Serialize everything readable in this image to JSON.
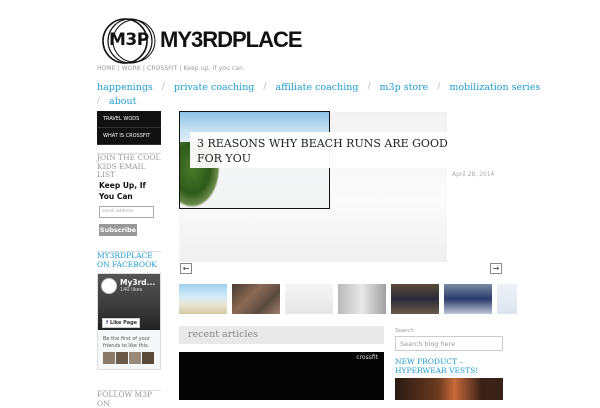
{
  "header": {
    "logo_mono": "M3P",
    "logo_word": "MY3RDPLACE",
    "tagline": "HOME | WORK | CROSSFIT | Keep up, if you can."
  },
  "nav": {
    "row1": [
      "happenings",
      "private coaching",
      "affiliate coaching",
      "m3p store",
      "mobilization series"
    ],
    "row2": [
      "about"
    ]
  },
  "sidebar": {
    "menu": [
      "TRAVEL WODS",
      "WHAT IS CROSSFIT"
    ],
    "email_heading": "JOIN THE COOL KIDS EMAIL LIST",
    "keep_up": "Keep Up, If You Can",
    "email_placeholder": "email address",
    "subscribe_label": "Subscribe",
    "facebook_heading": "MY3RDPLACE ON FACEBOOK",
    "facebook": {
      "page_name": "My3rd...",
      "likes": "140 likes",
      "like_button": "Like Page",
      "friends_text": "Be the first of your friends to like this."
    },
    "follow_heading": "FOLLOW M3P ON"
  },
  "slider": {
    "title": "3 REASONS WHY BEACH RUNS ARE GOOD FOR YOU",
    "date": "April 28, 2014",
    "prev": "←",
    "next": "→"
  },
  "recent": {
    "heading": "recent articles",
    "video_tag": "crossfit"
  },
  "right_sidebar": {
    "search_label": "Search",
    "search_placeholder": "Search blog here",
    "new_product": "NEW PRODUCT – HYPERWEAR VESTS!"
  },
  "colors": {
    "accent": "#1f9bcf",
    "dark": "#111111"
  }
}
